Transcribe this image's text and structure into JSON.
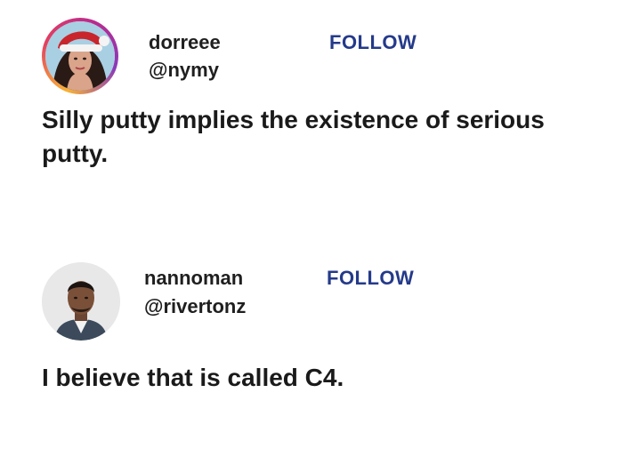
{
  "posts": [
    {
      "name": "dorreee",
      "handle": "@nymy",
      "follow_label": "FOLLOW",
      "text": "Silly putty implies the existence of serious putty."
    },
    {
      "name": "nannoman",
      "handle": "@rivertonz",
      "follow_label": "FOLLOW",
      "text": "I believe that is called C4."
    }
  ],
  "colors": {
    "follow": "#243a8a",
    "text": "#1a1a1a",
    "background": "#ffffff"
  }
}
